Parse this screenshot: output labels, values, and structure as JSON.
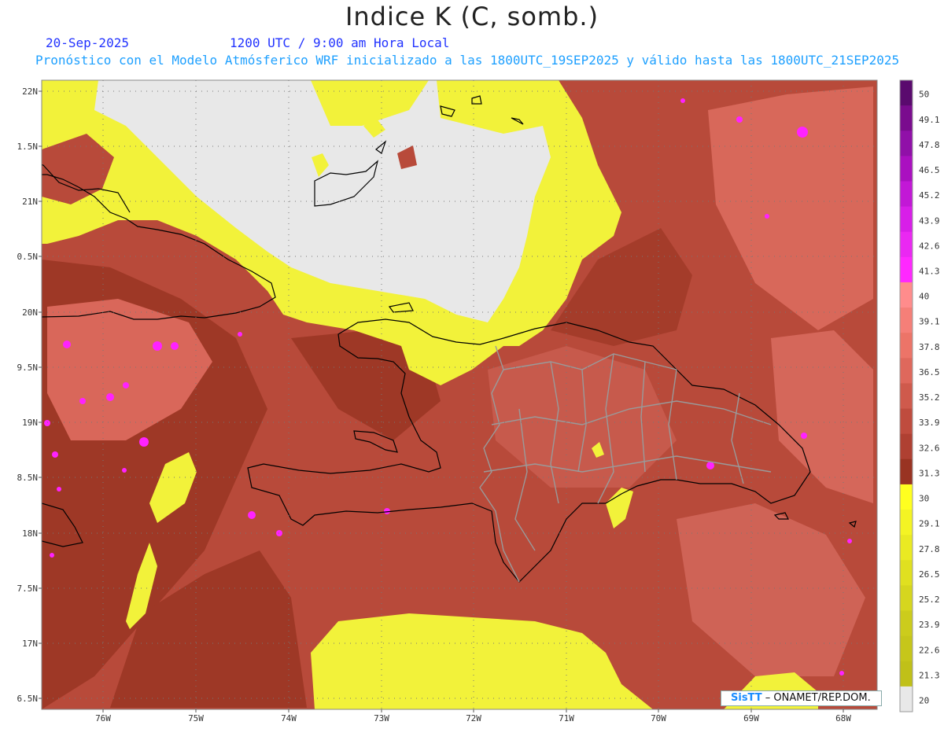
{
  "header": {
    "title": "Indice K (C, somb.)",
    "date": "20-Sep-2025",
    "time": "1200 UTC / 9:00 am Hora Local",
    "subtitle": "Pronóstico con el Modelo Atmósferico WRF inicializado a las 1800UTC_19SEP2025 y válido hasta las  1800UTC_21SEP2025"
  },
  "axes": {
    "lat_labels": [
      "22N",
      "1.5N",
      "21N",
      "0.5N",
      "20N",
      "9.5N",
      "19N",
      "8.5N",
      "18N",
      "7.5N",
      "17N",
      "6.5N"
    ],
    "lon_labels": [
      "76W",
      "75W",
      "74W",
      "73W",
      "72W",
      "71W",
      "70W",
      "69W",
      "68W"
    ]
  },
  "colorbar": {
    "labels": [
      "50",
      "49.1",
      "47.8",
      "46.5",
      "45.2",
      "43.9",
      "42.6",
      "41.3",
      "40",
      "39.1",
      "37.8",
      "36.5",
      "35.2",
      "33.9",
      "32.6",
      "31.3",
      "30",
      "29.1",
      "27.8",
      "26.5",
      "25.2",
      "23.9",
      "22.6",
      "21.3",
      "20"
    ],
    "colors": [
      "#5a0a6e",
      "#7a0c8e",
      "#9010a8",
      "#aa10c0",
      "#c218d6",
      "#d81ee8",
      "#ea28f2",
      "#ff28ff",
      "#ff8c8c",
      "#f57f78",
      "#ec7468",
      "#df685c",
      "#cf5a4c",
      "#bf4c3e",
      "#af4032",
      "#993322",
      "#ffff20",
      "#f4f424",
      "#eaea22",
      "#e0e020",
      "#d6d61e",
      "#cccc1c",
      "#c6c61a",
      "#c0c018",
      "#e8e8e8"
    ]
  },
  "credit": {
    "logo": "SisTT",
    "text": " – ONAMET/REP.DOM."
  }
}
